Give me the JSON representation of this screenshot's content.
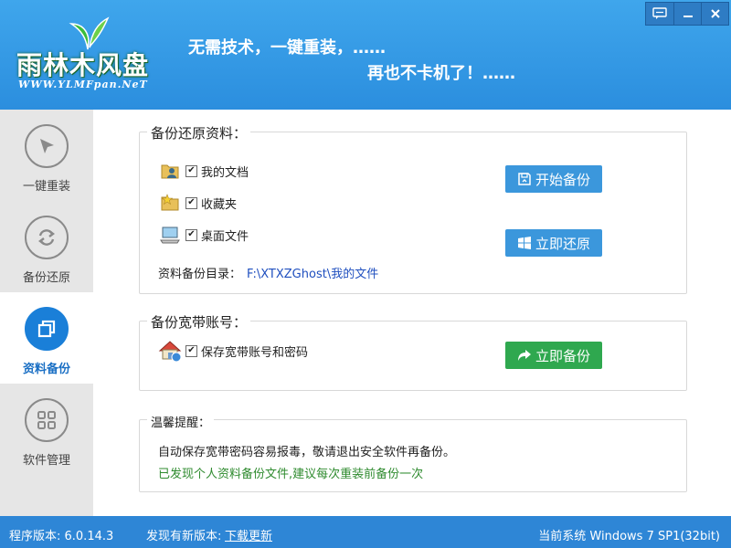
{
  "header": {
    "logo_title": "雨林木风盘",
    "logo_subtitle": "WWW.YLMFpan.NeT",
    "slogan_line1": "无需技术，一键重装，……",
    "slogan_line2": "再也不卡机了！……"
  },
  "window_controls": [
    "feedback-icon",
    "minimize-icon",
    "close-icon"
  ],
  "sidebar": {
    "items": [
      {
        "label": "一键重装",
        "icon": "cursor-arrow-icon",
        "active": false
      },
      {
        "label": "备份还原",
        "icon": "refresh-icon",
        "active": false
      },
      {
        "label": "资料备份",
        "icon": "copy-icon",
        "active": true
      },
      {
        "label": "软件管理",
        "icon": "grid-icon",
        "active": false
      }
    ]
  },
  "backup_section": {
    "title": "备份还原资料：",
    "items": [
      {
        "label": "我的文档",
        "checked": true,
        "icon": "user-folder-icon"
      },
      {
        "label": "收藏夹",
        "checked": true,
        "icon": "favorites-folder-icon"
      },
      {
        "label": "桌面文件",
        "checked": true,
        "icon": "desktop-icon"
      }
    ],
    "path_label": "资料备份目录：",
    "path_value": "F:\\XTXZGhost\\我的文件",
    "start_backup_label": "开始备份",
    "restore_label": "立即还原"
  },
  "broadband_section": {
    "title": "备份宽带账号：",
    "item_label": "保存宽带账号和密码",
    "checked": true,
    "backup_now_label": "立即备份"
  },
  "tips_section": {
    "title": "温馨提醒：",
    "line1": "自动保存宽带密码容易报毒，敬请退出安全软件再备份。",
    "line2": "已发现个人资料备份文件,建议每次重装前备份一次"
  },
  "statusbar": {
    "version": "程序版本: 6.0.14.3",
    "new_version": "发现有新版本:",
    "download_link": "下载更新",
    "system": "当前系统 Windows 7 SP1(32bit)"
  },
  "colors": {
    "header_blue": "#3fa6ec",
    "active_blue": "#1a7fd8",
    "button_blue": "#3b97dc",
    "button_green": "#2fa84f",
    "tip_green": "#2f8b2f",
    "statusbar_blue": "#2e86d6"
  }
}
